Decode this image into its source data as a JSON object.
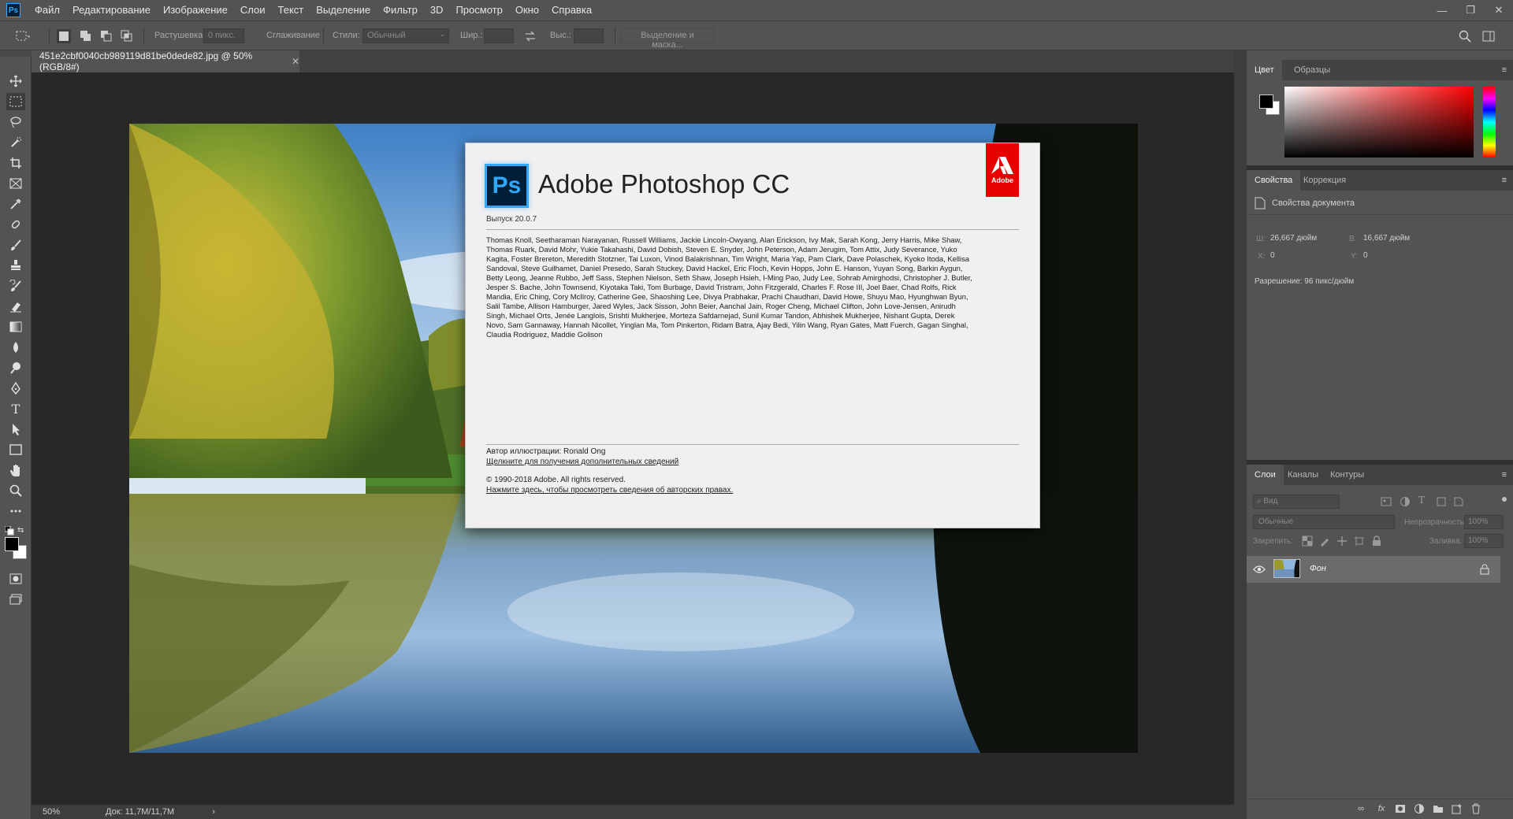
{
  "menubar": {
    "app_icon": "Ps",
    "items": [
      "Файл",
      "Редактирование",
      "Изображение",
      "Слои",
      "Текст",
      "Выделение",
      "Фильтр",
      "3D",
      "Просмотр",
      "Окно",
      "Справка"
    ],
    "controls": {
      "minimize": "—",
      "restore": "❐",
      "close": "✕"
    }
  },
  "options": {
    "feather_label": "Растушевка:",
    "feather_value": "0 пикс.",
    "antialias_label": "Сглаживание",
    "style_label": "Стили:",
    "style_value": "Обычный",
    "width_label": "Шир.:",
    "height_label": "Выс.:",
    "select_mask": "Выделение и маска..."
  },
  "document": {
    "tab_title": "451e2cbf0040cb989119d81be0dede82.jpg @ 50% (RGB/8#)",
    "tab_close": "✕",
    "zoom": "50%",
    "doc_info": "Док: 11,7M/11,7M",
    "status_arrow": "›"
  },
  "about": {
    "icon": "Ps",
    "title": "Adobe Photoshop CC",
    "adobe_mark": "Adobe",
    "version": "Выпуск 20.0.7",
    "credits": "Thomas Knoll, Seetharaman Narayanan, Russell Williams, Jackie Lincoln-Owyang, Alan Erickson, Ivy Mak, Sarah Kong, Jerry Harris, Mike Shaw, Thomas Ruark, David Mohr, Yukie Takahashi, David Dobish, Steven E. Snyder, John Peterson, Adam Jerugim, Tom Attix, Judy Severance, Yuko Kagita, Foster Brereton, Meredith Stotzner, Tai Luxon, Vinod Balakrishnan, Tim Wright, Maria Yap, Pam Clark, Dave Polaschek, Kyoko Itoda, Kellisa Sandoval, Steve Guilhamet, Daniel Presedo, Sarah Stuckey, David Hackel, Eric Floch, Kevin Hopps, John E. Hanson, Yuyan Song, Barkin Aygun, Betty Leong, Jeanne Rubbo, Jeff Sass, Stephen Nielson, Seth Shaw, Joseph Hsieh, I-Ming Pao, Judy Lee, Sohrab Amirghodsi, Christopher J. Butler, Jesper S. Bache, John Townsend, Kiyotaka Taki, Tom Burbage, David Tristram, John Fitzgerald, Charles F. Rose III, Joel Baer, Chad Rolfs, Rick Mandia, Eric Ching, Cory McIlroy, Catherine Gee, Shaoshing Lee, Divya Prabhakar, Prachi Chaudhari, David Howe, Shuyu Mao, Hyunghwan Byun, Salil Tambe, Allison Hamburger, Jared Wyles, Jack Sisson, John Beier, Aanchal Jain, Roger Cheng, Michael Clifton, John Love-Jensen, Anirudh Singh, Michael Orts, Jenée Langlois, Srishti Mukherjee, Morteza Safdarnejad, Sunil Kumar Tandon, Abhishek Mukherjee, Nishant Gupta, Derek Novo, Sam Gannaway, Hannah Nicollet, Yinglan Ma, Tom Pinkerton, Ridam Batra, Ajay Bedi, Yilin Wang, Ryan Gates, Matt Fuerch, Gagan Singhal, Claudia Rodriguez, Maddie Golison",
    "illustration_author": "Автор иллюстрации: Ronald Ong",
    "illustration_link": "Щелкните для получения дополнительных сведений",
    "copyright": "© 1990-2018 Adobe. All rights reserved.",
    "copyright_link": "Нажмите здесь, чтобы просмотреть сведения об авторских правах."
  },
  "panels": {
    "color_tabs": [
      "Цвет",
      "Образцы"
    ],
    "props_tabs": [
      "Свойства",
      "Коррекция"
    ],
    "doc_props_label": "Свойства документа",
    "w_label": "Ш:",
    "w_value": "26,667 дюйм",
    "h_label": "В:",
    "h_value": "16,667 дюйм",
    "x_label": "X:",
    "x_value": "0",
    "y_label": "Y:",
    "y_value": "0",
    "resolution": "Разрешение: 96 пикс/дюйм",
    "layers_tabs": [
      "Слои",
      "Каналы",
      "Контуры"
    ],
    "filter_placeholder": "Вид",
    "blend_mode": "Обычные",
    "opacity_label": "Непрозрачность:",
    "opacity_value": "100%",
    "lock_label": "Закрепить:",
    "fill_label": "Заливка:",
    "fill_value": "100%",
    "layer_name": "Фон",
    "panel_menu": "≡"
  },
  "colors": {
    "ps_blue": "#31a8ff",
    "adobe_red": "#e80000",
    "foreground": "#000000",
    "background": "#ffffff"
  }
}
